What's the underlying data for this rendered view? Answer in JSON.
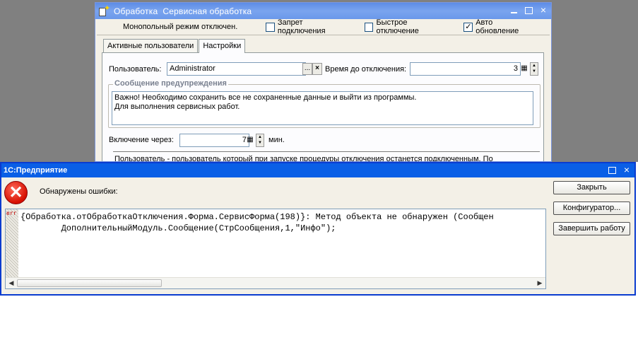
{
  "bg_window": {
    "title": "Обработка  Сервисная обработка",
    "mono_mode": "Монопольный режим отключен.",
    "options": [
      {
        "label": "Запрет подключения",
        "checked": false
      },
      {
        "label": "Быстрое отключение",
        "checked": false
      },
      {
        "label": "Авто обновление",
        "checked": true
      }
    ],
    "tabs": [
      {
        "label": "Активные пользователи",
        "active": false
      },
      {
        "label": "Настройки",
        "active": true
      }
    ],
    "user_label": "Пользователь:",
    "user_value": "Administrator",
    "time_label": "Время до отключения:",
    "time_value": "3",
    "warning_group_title": "Сообщение предупреждения",
    "warning_line1": "Важно! Необходимо сохранить все не сохраненные данные и выйти из программы.",
    "warning_line2": "Для выполнения сервисных работ.",
    "enable_label": "Включение через:",
    "enable_value": "7",
    "enable_unit": "мин.",
    "note": "Пользователь - пользователь который при запуске процедуры отключения останется подключенным. По"
  },
  "dialog": {
    "title": "1С:Предприятие",
    "errors_label": "Обнаружены ошибки:",
    "err_badge": "err",
    "error_line1": "{Обработка.отОбработкаОтключения.Форма.СервисФорма(198)}: Метод объекта не обнаружен (Сообщен",
    "error_line2": "        ДополнительныйМодуль.Сообщение(СтрСообщения,1,\"Инфо\");",
    "buttons": {
      "close": "Закрыть",
      "configurator": "Конфигуратор...",
      "finish": "Завершить работу"
    }
  },
  "icons": {
    "window_close": "×",
    "error": "✕",
    "ellipsis": "...",
    "clear": "×",
    "calc": "▦",
    "spin_up": "▲",
    "spin_down": "▼",
    "scroll_left": "◀",
    "scroll_right": "▶",
    "check": "✓"
  },
  "colors": {
    "bg_title": "#6a98ea",
    "dialog_title": "#0a5fe6",
    "error_red": "#d60f00",
    "group_title": "#7a8190"
  }
}
